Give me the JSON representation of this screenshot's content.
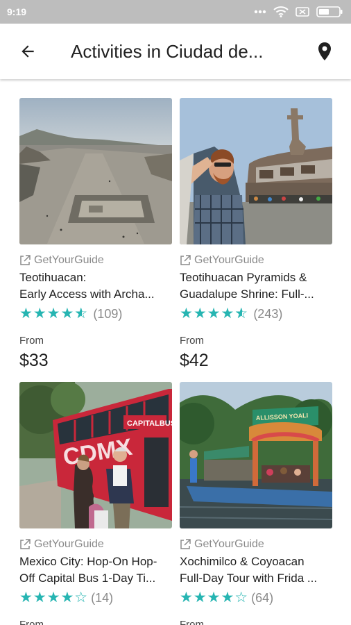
{
  "status_bar": {
    "time": "9:19"
  },
  "app_bar": {
    "title": "Activities in Ciudad de..."
  },
  "cards": [
    {
      "provider": "GetYourGuide",
      "title_line1": "Teotihuacan:",
      "title_line2": "Early Access with Archa...",
      "stars": "★★★★",
      "half_star": "★",
      "reviews": "(109)",
      "from": "From",
      "price": "$33"
    },
    {
      "provider": "GetYourGuide",
      "title_line1": "Teotihuacan Pyramids &",
      "title_line2": "Guadalupe Shrine: Full-...",
      "stars": "★★★★",
      "half_star": "★",
      "reviews": "(243)",
      "from": "From",
      "price": "$42"
    },
    {
      "provider": "GetYourGuide",
      "title_line1": "Mexico City: Hop-On Hop-",
      "title_line2": "Off Capital Bus 1-Day Ti...",
      "stars": "★★★★☆",
      "reviews": "(14)",
      "from": "From"
    },
    {
      "provider": "GetYourGuide",
      "title_line1": "Xochimilco & Coyoacan",
      "title_line2": "Full-Day Tour with Frida ...",
      "stars": "★★★★☆",
      "reviews": "(64)",
      "from": "From"
    }
  ],
  "bus_sign": "CAPITALBUS",
  "bus_side_text": "CDMX",
  "boat_sign": "ALLISSON YOALI"
}
